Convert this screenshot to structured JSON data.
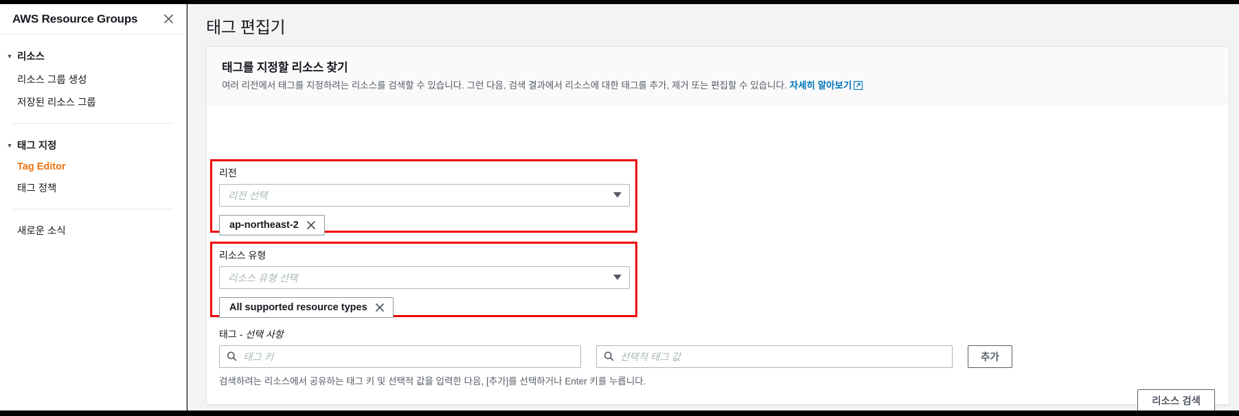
{
  "sidebar": {
    "title": "AWS Resource Groups",
    "close_icon": "close-icon",
    "groups": [
      {
        "label": "리소스",
        "caret": "▼",
        "items": [
          {
            "label": "리소스 그룹 생성",
            "active": false
          },
          {
            "label": "저장된 리소스 그룹",
            "active": false
          }
        ]
      },
      {
        "label": "태그 지정",
        "caret": "▼",
        "items": [
          {
            "label": "Tag Editor",
            "active": true
          },
          {
            "label": "태그 정책",
            "active": false
          }
        ]
      }
    ],
    "whats_new": "새로운 소식",
    "accent_color": "#ec7211"
  },
  "main": {
    "page_title": "태그 편집기",
    "card": {
      "title": "태그를 지정할 리소스 찾기",
      "description": "여러 리전에서 태그를 지정하려는 리소스를 검색할 수 있습니다. 그런 다음, 검색 결과에서 리소스에 대한 태그를 추가, 제거 또는 편집할 수 있습니다.",
      "learn_more": "자세히 알아보기",
      "learn_more_icon": "external-link-icon",
      "link_color": "#0073bb"
    },
    "region_section": {
      "label": "리전",
      "select_placeholder": "리전 선택",
      "dropdown_icon": "chevron-down-icon",
      "chips": [
        {
          "label": "ap-northeast-2",
          "remove_icon": "close-icon"
        }
      ],
      "highlight_color": "#ee0000"
    },
    "resource_type_section": {
      "label": "리소스 유형",
      "select_placeholder": "리소스 유형 선택",
      "dropdown_icon": "chevron-down-icon",
      "chips": [
        {
          "label": "All supported resource types",
          "remove_icon": "close-icon"
        }
      ],
      "highlight_color": "#ee0000"
    },
    "tags_section": {
      "label_main": "태그",
      "label_optional": "- 선택 사항",
      "key_placeholder": "태그 키",
      "key_value": "",
      "value_placeholder": "선택적 태그 값",
      "value_value": "",
      "search_icon": "search-icon",
      "add_button": "추가",
      "hint": "검색하려는 리소스에서 공유하는 태그 키 및 선택적 값을 입력한 다음, [추가]를 선택하거나 Enter 키를 누릅니다."
    },
    "footer": {
      "search_resources_button": "리소스 검색"
    }
  }
}
